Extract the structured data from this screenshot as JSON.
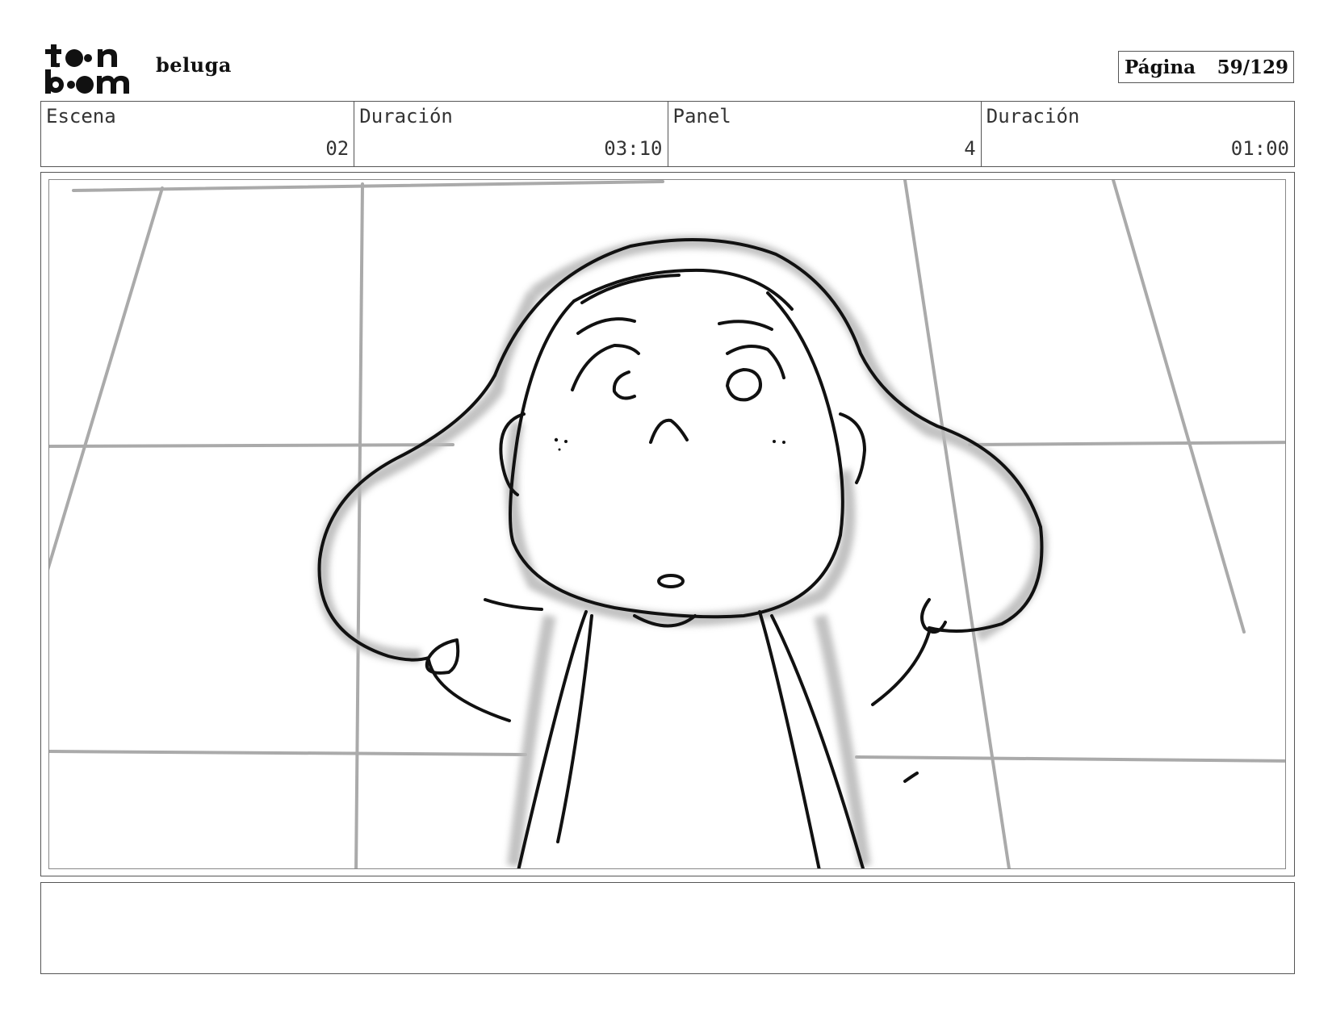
{
  "header": {
    "logo_text_top": "toon",
    "logo_text_bottom": "boom",
    "project_name": "beluga",
    "page_label": "Página",
    "page_value": "59/129"
  },
  "info": {
    "scene_label": "Escena",
    "scene_value": "02",
    "scene_duration_label": "Duración",
    "scene_duration_value": "03:10",
    "panel_label": "Panel",
    "panel_value": "4",
    "panel_duration_label": "Duración",
    "panel_duration_value": "01:00"
  },
  "notes": {
    "text": ""
  }
}
